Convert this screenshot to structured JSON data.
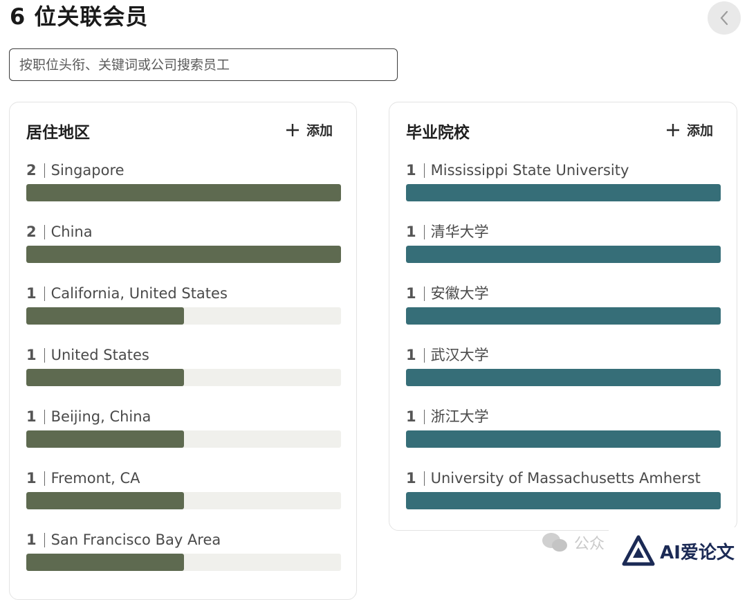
{
  "header": {
    "title": "6 位关联会员",
    "search_placeholder": "按职位头衔、关键词或公司搜索员工"
  },
  "location_card": {
    "title": "居住地区",
    "add_label": "添加",
    "bar_color": "#5e6a50",
    "items": [
      {
        "count": "2",
        "name": "Singapore",
        "fill": 1.0
      },
      {
        "count": "2",
        "name": "China",
        "fill": 1.0
      },
      {
        "count": "1",
        "name": "California, United States",
        "fill": 0.5
      },
      {
        "count": "1",
        "name": "United States",
        "fill": 0.5
      },
      {
        "count": "1",
        "name": "Beijing, China",
        "fill": 0.5
      },
      {
        "count": "1",
        "name": "Fremont, CA",
        "fill": 0.5
      },
      {
        "count": "1",
        "name": "San Francisco Bay Area",
        "fill": 0.5
      }
    ]
  },
  "school_card": {
    "title": "毕业院校",
    "add_label": "添加",
    "bar_color": "#366e78",
    "items": [
      {
        "count": "1",
        "name": "Mississippi State University",
        "fill": 1.0
      },
      {
        "count": "1",
        "name": "清华大学",
        "fill": 1.0
      },
      {
        "count": "1",
        "name": "安徽大学",
        "fill": 1.0
      },
      {
        "count": "1",
        "name": "武汉大学",
        "fill": 1.0
      },
      {
        "count": "1",
        "name": "浙江大学",
        "fill": 1.0
      },
      {
        "count": "1",
        "name": "University of Massachusetts Amherst",
        "fill": 1.0
      }
    ]
  },
  "watermark": {
    "faded_text": "公众",
    "brand_text": "AI爱论文",
    "icon": "wechat-icon",
    "logo_icon": "ai-logo-icon"
  }
}
